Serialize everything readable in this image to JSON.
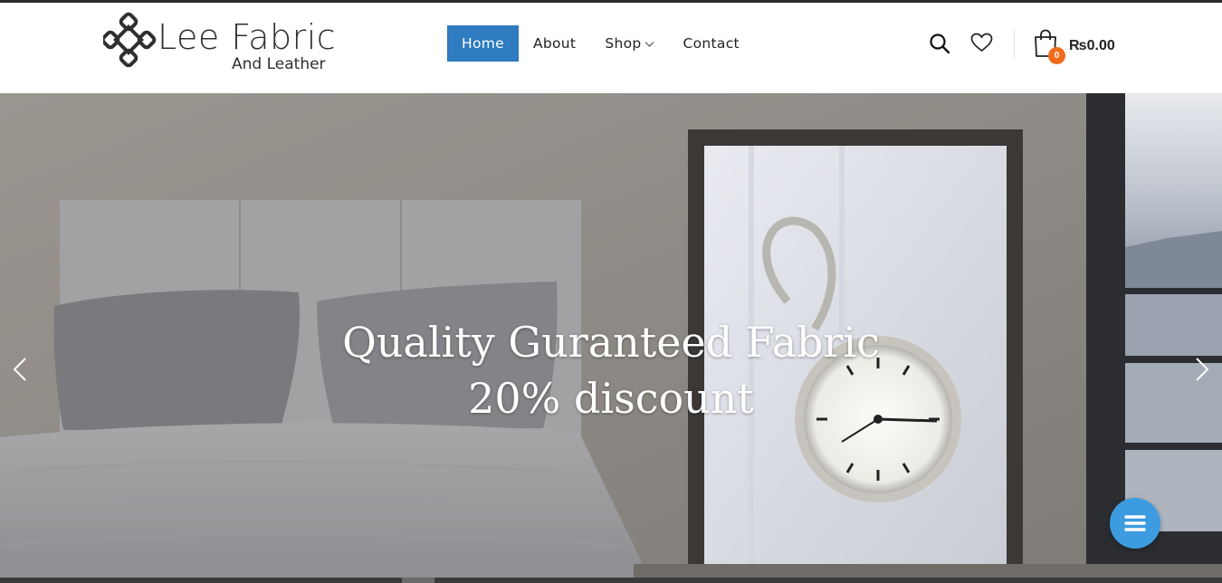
{
  "brand": {
    "title": "Lee Fabric",
    "subtitle": "And Leather",
    "logo_icon": "celtic-knot-icon"
  },
  "nav": {
    "items": [
      {
        "label": "Home",
        "active": true
      },
      {
        "label": "About",
        "active": false
      },
      {
        "label": "Shop",
        "active": false,
        "has_dropdown": true
      },
      {
        "label": "Contact",
        "active": false
      }
    ]
  },
  "header_actions": {
    "search_icon": "search-icon",
    "wishlist_icon": "heart-icon",
    "cart_icon": "shopping-bag-icon",
    "cart_count": "0",
    "cart_total": "₨0.00"
  },
  "hero": {
    "line1": "Quality Guranteed Fabric",
    "line2": "20% discount",
    "prev_icon": "chevron-left-icon",
    "next_icon": "chevron-right-icon"
  },
  "fab": {
    "icon": "menu-icon"
  },
  "colors": {
    "accent": "#2e7bbf",
    "badge": "#f26b1d",
    "fab": "#3d9be0",
    "text": "#222222"
  }
}
